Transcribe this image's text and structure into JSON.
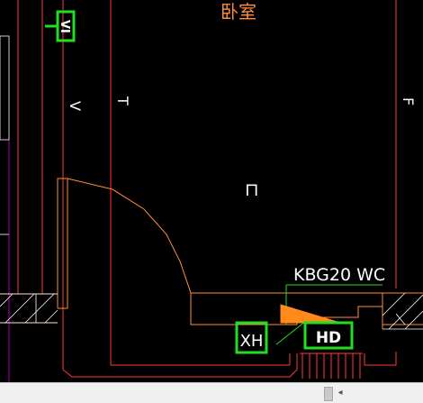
{
  "drawing": {
    "room_label": "卧室",
    "marker_v": "V",
    "marker_t": "T",
    "marker_f": "F",
    "marker_vi": "VI",
    "pipe_label": "KBG20 WC",
    "box_xh": "XH",
    "box_hd": "HD",
    "door_mark": "⊓"
  },
  "colors": {
    "background": "#000000",
    "wall_red": "#ff3b3b",
    "wall_orange": "#ff8c3a",
    "green": "#22dd22",
    "magenta": "#b000b0",
    "white": "#ffffff",
    "hatch": "#ffffff"
  },
  "scrollbar": {
    "left_arrow": "◂"
  }
}
